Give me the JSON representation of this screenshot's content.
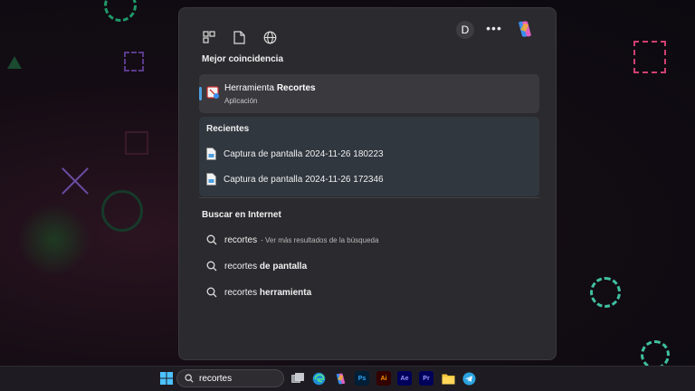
{
  "search_panel": {
    "top_bar": {
      "avatar_letter": "D",
      "more_label": "•••"
    },
    "best_match": {
      "heading": "Mejor coincidencia",
      "app_name_prefix": "Herramienta ",
      "app_name_match": "Recortes",
      "app_kind": "Aplicación"
    },
    "recents": {
      "heading": "Recientes",
      "items": [
        "Captura de pantalla 2024-11-26 180223",
        "Captura de pantalla 2024-11-26 172346"
      ]
    },
    "web": {
      "heading": "Buscar en Internet",
      "items": [
        {
          "query": "recortes",
          "suffix": "",
          "hint": "- Ver más resultados de la búsqueda"
        },
        {
          "query": "recortes ",
          "suffix": "de pantalla",
          "hint": ""
        },
        {
          "query": "recortes ",
          "suffix": "herramienta",
          "hint": ""
        }
      ]
    }
  },
  "taskbar": {
    "search_value": "recortes",
    "apps": [
      {
        "label": "Ps",
        "color": "#31a8ff",
        "bg": "#001e36"
      },
      {
        "label": "Ai",
        "color": "#ff9a00",
        "bg": "#330000"
      },
      {
        "label": "Ae",
        "color": "#9999ff",
        "bg": "#00005b"
      },
      {
        "label": "Pr",
        "color": "#9999ff",
        "bg": "#00005b"
      }
    ]
  },
  "colors": {
    "accent": "#4ca0e0",
    "panel": "#2b2a2e",
    "taskbar": "#1e1c22"
  }
}
